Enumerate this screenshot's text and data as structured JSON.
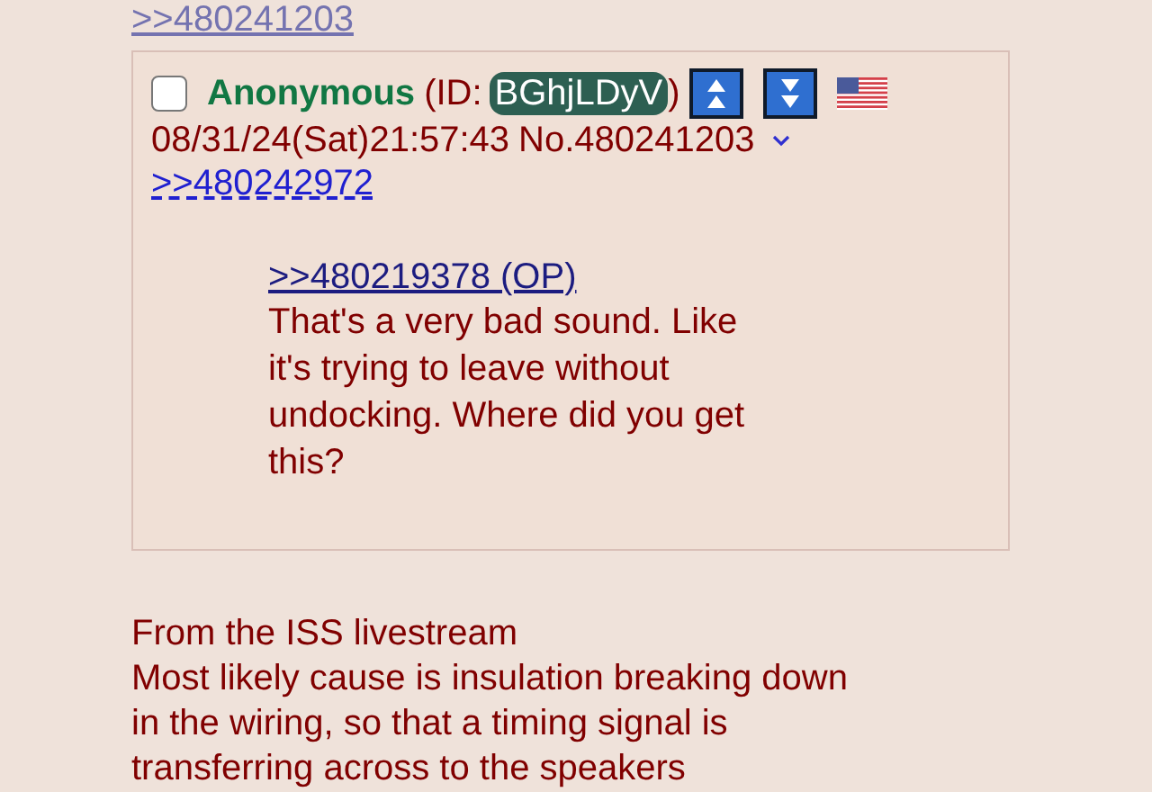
{
  "top_link": ">>480241203",
  "post": {
    "checked": false,
    "name": "Anonymous",
    "id_prefix": "(ID:",
    "id": "BGhjLDyV",
    "id_suffix": ")",
    "datetime": "08/31/24(Sat)21:57:43",
    "number": "No.480241203",
    "backlinks": [
      ">>480242972"
    ],
    "quote_link": ">>480219378 (OP)",
    "message": "That's a very bad sound. Like it's trying to leave without undocking. Where did you get this?"
  },
  "next_post": {
    "lines": [
      "From the ISS livestream",
      "Most likely cause is insulation breaking down",
      "in the wiring, so that a timing signal is",
      "transferring across to the speakers"
    ]
  }
}
